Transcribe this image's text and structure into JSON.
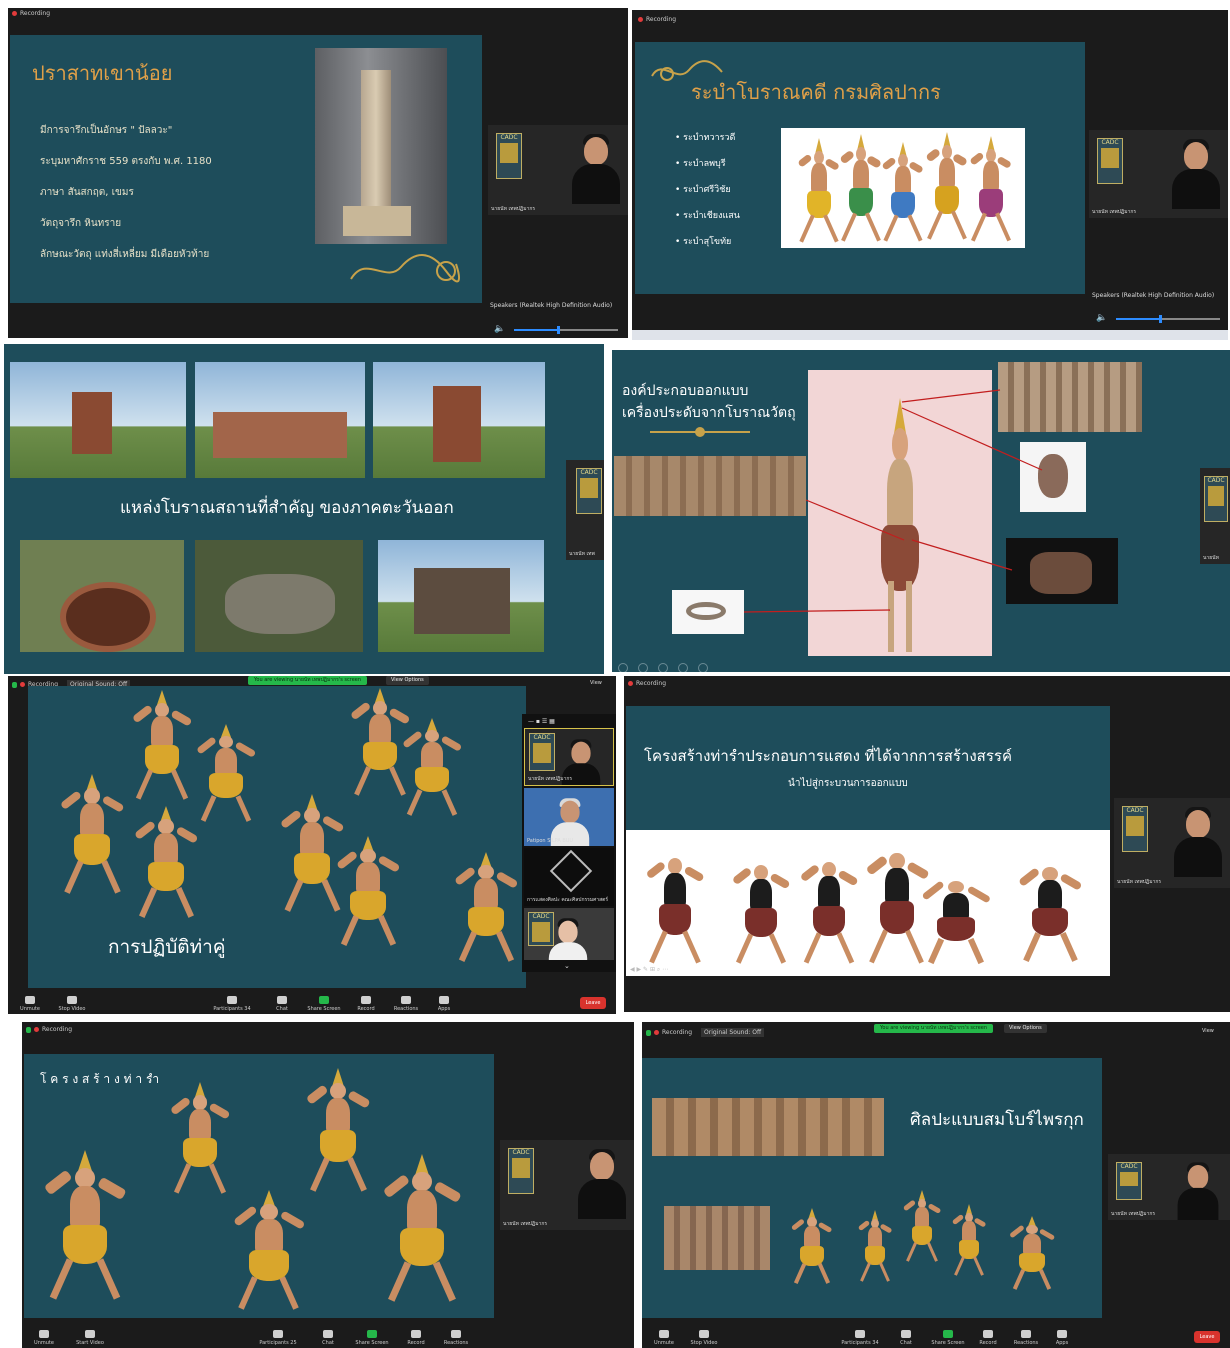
{
  "common": {
    "recording": "Recording",
    "original_sound": "Original Sound: Off",
    "viewing_banner": "You are viewing นายนัท เทพปฏิมากร's screen",
    "view_options": "View Options",
    "view": "View",
    "speakers_label": "Speakers (Realtek High Definition Audio)",
    "cadc": "CADC",
    "speaker_name": "นายนัท เทพปฏิมากร",
    "speaker_volume_fraction": 0.42
  },
  "toolbar": {
    "unmute": "Unmute",
    "stop_video": "Stop Video",
    "start_video": "Start Video",
    "participants": "Participants",
    "participants_count_a": "34",
    "participants_count_b": "25",
    "chat": "Chat",
    "share_screen": "Share Screen",
    "record": "Record",
    "reactions": "Reactions",
    "apps": "Apps",
    "leave": "Leave"
  },
  "panel1": {
    "title": "ปราสาทเขาน้อย",
    "lines": [
      "มีการจารึกเป็นอักษร \" ปัลลวะ\"",
      "ระบุมหาศักราช 559 ตรงกับ พ.ศ. 1180",
      "ภาษา สันสกฤต, เขมร",
      "วัตถุจารึก หินทราย",
      "ลักษณะวัตถุ แท่งสี่เหลี่ยม มีเดือยหัวท้าย"
    ]
  },
  "panel2": {
    "title": "ระบำโบราณคดี กรมศิลปากร",
    "bullets": [
      "ระบำทวารวดี",
      "ระบำลพบุรี",
      "ระบำศรีวิชัย",
      "ระบำเชียงแสน",
      "ระบำสุโขทัย"
    ]
  },
  "panel3": {
    "caption": "แหล่งโบราณสถานที่สำคัญ ของภาคตะวันออก",
    "cadc": "CADC",
    "name_partial": "นายนัท เทพ"
  },
  "panel4": {
    "title_line1": "องค์ประกอบออกแบบ",
    "title_line2": "เครื่องประดับจากโบราณวัตถุ",
    "cadc_partial": "CADC",
    "name_partial": "นายนัท"
  },
  "panel5": {
    "caption": "การปฏิบัติท่าคู่",
    "participants": [
      {
        "name": "นายนัท เทพปฏิมากร"
      },
      {
        "name": "Patipon SILPA BUU"
      },
      {
        "name": "การเเสดงศิลปะ คณะศิลปกรรมศาสตร์"
      },
      {
        "name": ""
      }
    ]
  },
  "panel6": {
    "title": "โครงสร้างท่ารำประกอบการแสดง ที่ได้จากการสร้างสรรค์",
    "subtitle": "นำไปสู่กระบวนการออกแบบ"
  },
  "panel7": {
    "title": "โ ค ร ง ส ร้ า ง ท่ า รำ"
  },
  "panel8": {
    "title": "ศิลปะแบบสมโบร์ไพรกุก"
  }
}
